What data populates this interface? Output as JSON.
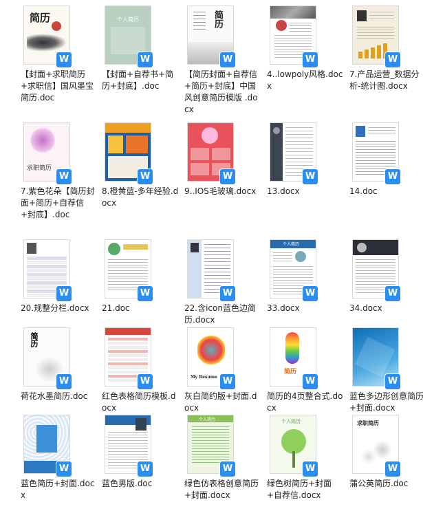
{
  "badge_label": "W",
  "files": [
    {
      "name": "【封面+求职简历+求职信】国风墨宝简历.doc",
      "style": "ink"
    },
    {
      "name": "【封面+自荐书+简历+封底】.doc",
      "style": "green"
    },
    {
      "name": "【简历封面+自荐信+简历+封底】中国风创意简历模版 .docx",
      "style": "chinese"
    },
    {
      "name": "4..lowpoly风格.docx",
      "style": "lowpoly"
    },
    {
      "name": "7.产品运营_数据分析-统计图.docx",
      "style": "product"
    },
    {
      "name": "7.紫色花朵【简历封面+简历+自荐信+封底】.doc",
      "style": "flower"
    },
    {
      "name": "8.橙黄蓝-多年经验.docx",
      "style": "orange"
    },
    {
      "name": "9..IOS毛玻璃.docx",
      "style": "ios"
    },
    {
      "name": "13.docx",
      "style": "darkside"
    },
    {
      "name": "14.doc",
      "style": "bluehead"
    },
    {
      "name": "20.规整分栏.docx",
      "style": "table"
    },
    {
      "name": "21.doc",
      "style": "avatarlist"
    },
    {
      "name": "22.含icon蓝色边简历.docx",
      "style": "blueside"
    },
    {
      "name": "33.docx",
      "style": "bluetop"
    },
    {
      "name": "34.docx",
      "style": "darktop"
    },
    {
      "name": "荷花水墨简历.doc",
      "style": "lotus"
    },
    {
      "name": "红色表格简历模板.docx",
      "style": "redtable"
    },
    {
      "name": "灰白简约版+封面.docx",
      "style": "gray"
    },
    {
      "name": "简历的4页整合式.docx",
      "style": "fourpage"
    },
    {
      "name": "蓝色多边形创意简历+封面.docx",
      "style": "polyblue"
    },
    {
      "name": "蓝色简历+封面.docx",
      "style": "bluepattern"
    },
    {
      "name": "蓝色男版.doc",
      "style": "blueman"
    },
    {
      "name": "绿色仿表格创意简历+封面.docx",
      "style": "greentable"
    },
    {
      "name": "绿色树简历+封面+自荐信.docx",
      "style": "tree"
    },
    {
      "name": "蒲公英简历.doc",
      "style": "dandelion"
    }
  ],
  "thumb_text": {
    "jianli": "简历",
    "geren": "个人简历",
    "qiuzhi": "求职简历",
    "resume": "My Resume",
    "qiuzhijianli": "求职简历"
  }
}
